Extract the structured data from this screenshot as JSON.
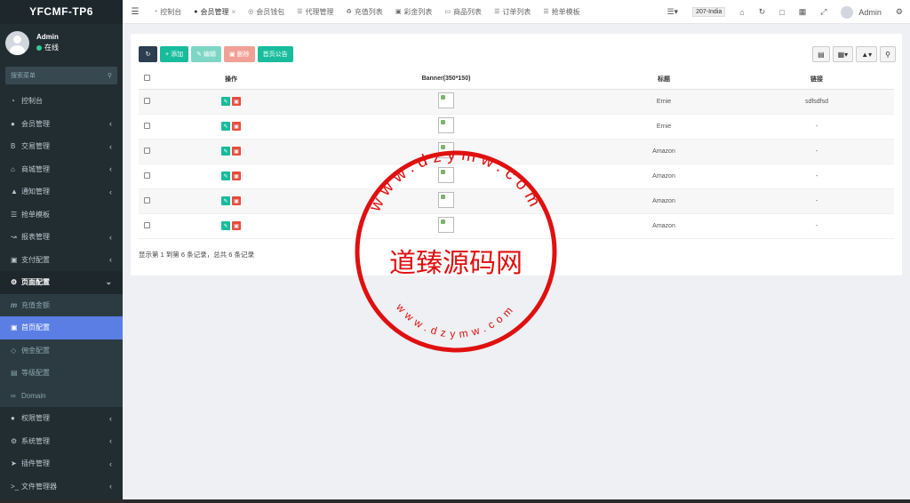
{
  "sidebar": {
    "brand": "YFCMF-TP6",
    "user": {
      "name": "Admin",
      "status": "在线"
    },
    "search_placeholder": "搜索菜单",
    "items": [
      {
        "label": "控制台",
        "icon": "dashboard-icon"
      },
      {
        "label": "会员管理",
        "icon": "user-icon"
      },
      {
        "label": "交易管理",
        "icon": "bitcoin-icon"
      },
      {
        "label": "商城管理",
        "icon": "home-icon"
      },
      {
        "label": "通知管理",
        "icon": "bell-icon"
      },
      {
        "label": "抢单模板",
        "icon": "sitemap-icon"
      },
      {
        "label": "报表管理",
        "icon": "chart-icon"
      },
      {
        "label": "支付配置",
        "icon": "card-icon"
      },
      {
        "label": "页面配置",
        "icon": "gear-icon"
      },
      {
        "label": "充值金额",
        "icon": "m-icon"
      },
      {
        "label": "首页配置",
        "icon": "image-icon"
      },
      {
        "label": "佣金配置",
        "icon": "diamond-icon"
      },
      {
        "label": "等级配置",
        "icon": "level-icon"
      },
      {
        "label": "Domain",
        "icon": "link-icon"
      },
      {
        "label": "权限管理",
        "icon": "group-icon"
      },
      {
        "label": "系统管理",
        "icon": "cogs-icon"
      },
      {
        "label": "插件管理",
        "icon": "rocket-icon"
      },
      {
        "label": "文件管理器",
        "icon": "terminal-icon"
      }
    ]
  },
  "topbar": {
    "tabs": [
      {
        "label": "控制台",
        "icon": "dashboard-icon"
      },
      {
        "label": "会员管理",
        "icon": "user-icon"
      },
      {
        "label": "会员钱包",
        "icon": "wallet-icon"
      },
      {
        "label": "代理管理",
        "icon": "sitemap-icon"
      },
      {
        "label": "充值列表",
        "icon": "cart-icon"
      },
      {
        "label": "彩金列表",
        "icon": "gift-icon"
      },
      {
        "label": "商品列表",
        "icon": "monitor-icon"
      },
      {
        "label": "订单列表",
        "icon": "list-icon"
      },
      {
        "label": "抢单模板",
        "icon": "sitemap-icon"
      }
    ],
    "lang": "207-India",
    "username": "Admin"
  },
  "toolbar": {
    "add": "添加",
    "edit": "编辑",
    "delete": "删除",
    "notice": "首页公告"
  },
  "table": {
    "headers": {
      "op": "操作",
      "banner": "Banner(350*150)",
      "title": "标题",
      "link": "链接"
    },
    "rows": [
      {
        "title": "Ernie",
        "link": "sdfsdfsd"
      },
      {
        "title": "Ernie",
        "link": "-"
      },
      {
        "title": "Amazon",
        "link": "-"
      },
      {
        "title": "Amazon",
        "link": "-"
      },
      {
        "title": "Amazon",
        "link": "-"
      },
      {
        "title": "Amazon",
        "link": "-"
      }
    ]
  },
  "pagination": {
    "summary": "显示第 1 到第 6 条记录，总共 6 条记录"
  },
  "watermark": {
    "text": "道臻源码网",
    "outer": "www.dzymw.com",
    "inner": "www.dzymw.com",
    "color": "#e01010"
  }
}
